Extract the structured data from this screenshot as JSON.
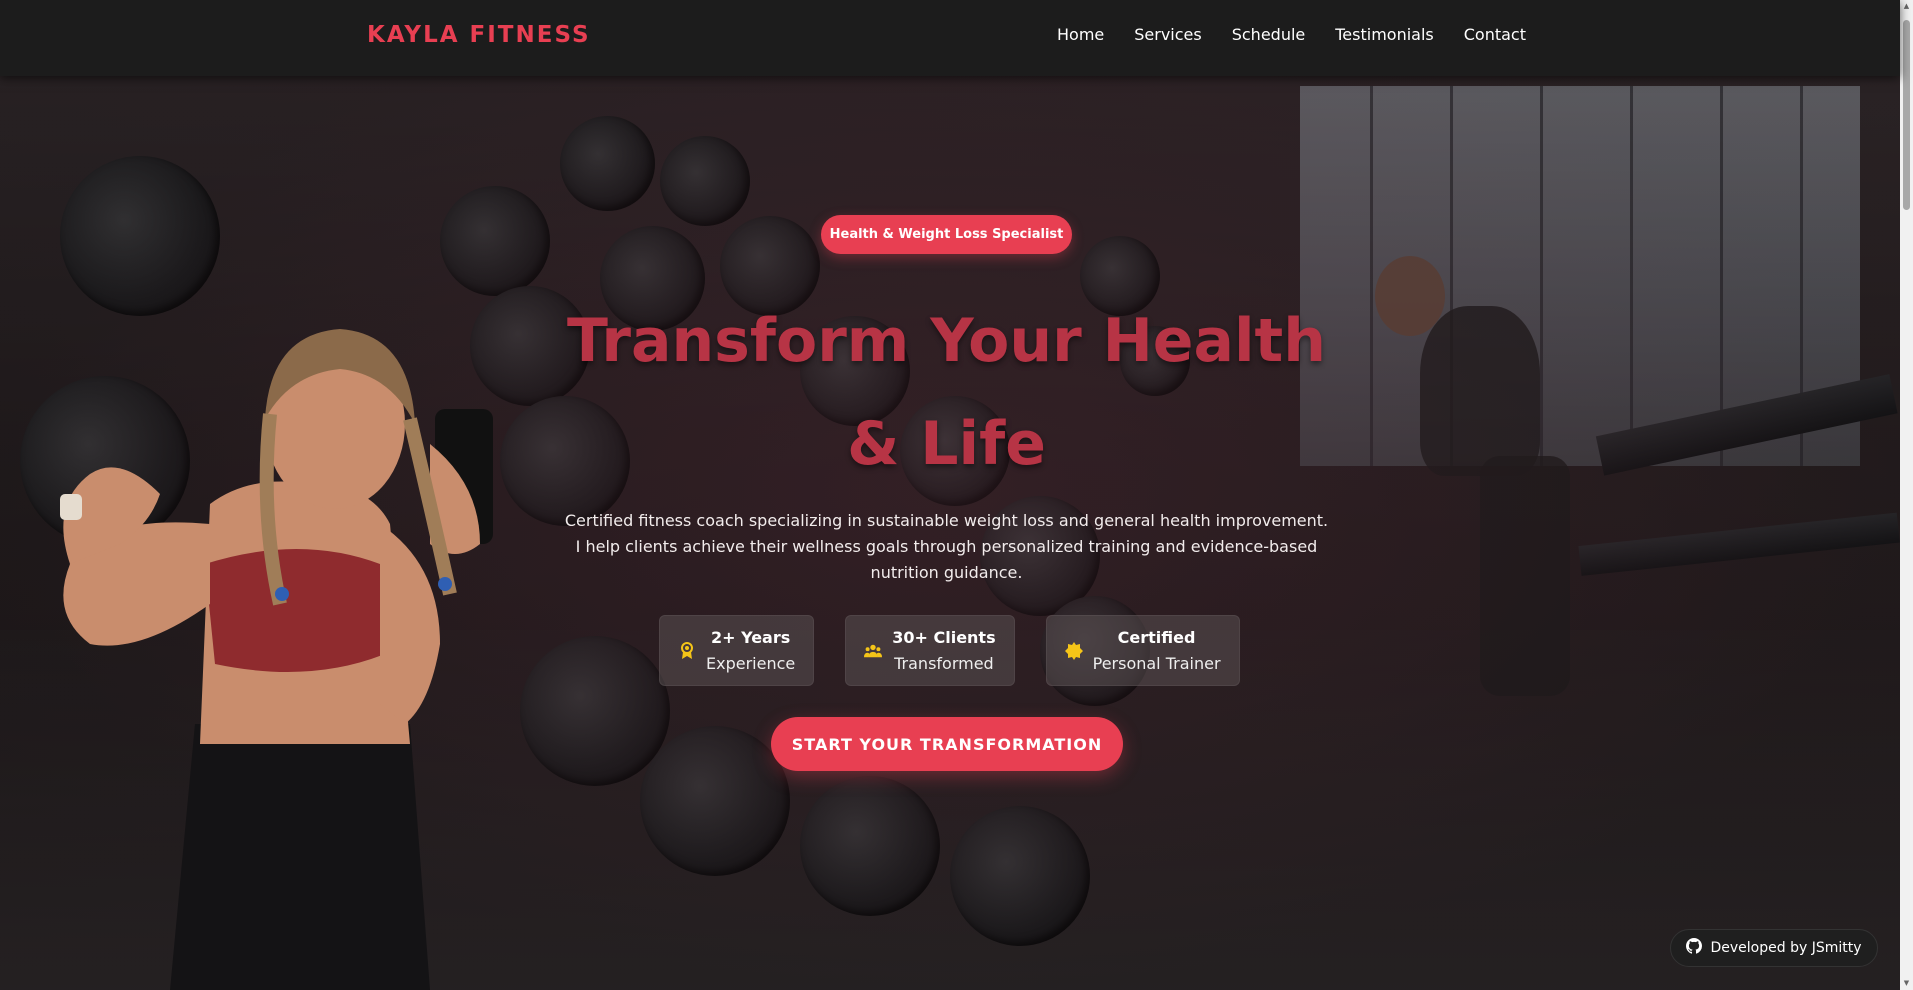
{
  "nav": {
    "brand": "KAYLA FITNESS",
    "links": [
      "Home",
      "Services",
      "Schedule",
      "Testimonials",
      "Contact"
    ]
  },
  "hero": {
    "badge": "Health & Weight Loss Specialist",
    "headline_line1": "Transform Your Health",
    "headline_line2": "& Life",
    "description": "Certified fitness coach specializing in sustainable weight loss and general health improvement. I help clients achieve their wellness goals through personalized training and evidence-based nutrition guidance.",
    "stats": [
      {
        "icon": "award-icon",
        "title": "2+ Years",
        "subtitle": "Experience"
      },
      {
        "icon": "users-icon",
        "title": "30+ Clients",
        "subtitle": "Transformed"
      },
      {
        "icon": "certificate-icon",
        "title": "Certified",
        "subtitle": "Personal Trainer"
      }
    ],
    "cta": "START YOUR TRANSFORMATION"
  },
  "footer_badge": {
    "icon": "github-icon",
    "label": "Developed by JSmitty"
  },
  "colors": {
    "accent": "#e83f52",
    "headline": "#b73445",
    "nav_bg": "#1c1c1c",
    "stat_icon": "#f5c518"
  }
}
